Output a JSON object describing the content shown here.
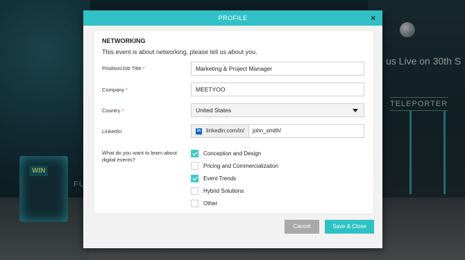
{
  "background": {
    "kiosk_label": "WIN",
    "floor_text": "FU",
    "wall_text": "us Live on 30th S",
    "teleporter": "TELEPORTER"
  },
  "modal": {
    "title": "PROFILE",
    "close": "×"
  },
  "form": {
    "section_title": "NETWORKING",
    "intro": "This event is about networking, please tell us about you.",
    "position": {
      "label": "Position/Job Title",
      "required": "*",
      "value": "Marketing & Project Manager"
    },
    "company": {
      "label": "Company",
      "required": "*",
      "value": "MEETYOO"
    },
    "country": {
      "label": "Country",
      "required": "*",
      "value": "United States"
    },
    "linkedin": {
      "label": "LinkedIn",
      "prefix": "linkedin.com/in/",
      "value": "john_smith/"
    },
    "learn": {
      "label": "What do you want to learn about digital events?",
      "options": [
        {
          "label": "Conception and Design",
          "checked": true
        },
        {
          "label": "Pricing and Commercialization",
          "checked": false
        },
        {
          "label": "Event Trends",
          "checked": true
        },
        {
          "label": "Hybrid Solutions",
          "checked": false
        },
        {
          "label": "Other",
          "checked": false
        }
      ]
    }
  },
  "buttons": {
    "cancel": "Cancel",
    "save": "Save & Close"
  },
  "colors": {
    "accent": "#2fc1c5",
    "checkbox_on": "#43c9c9",
    "required": "#e54646"
  }
}
